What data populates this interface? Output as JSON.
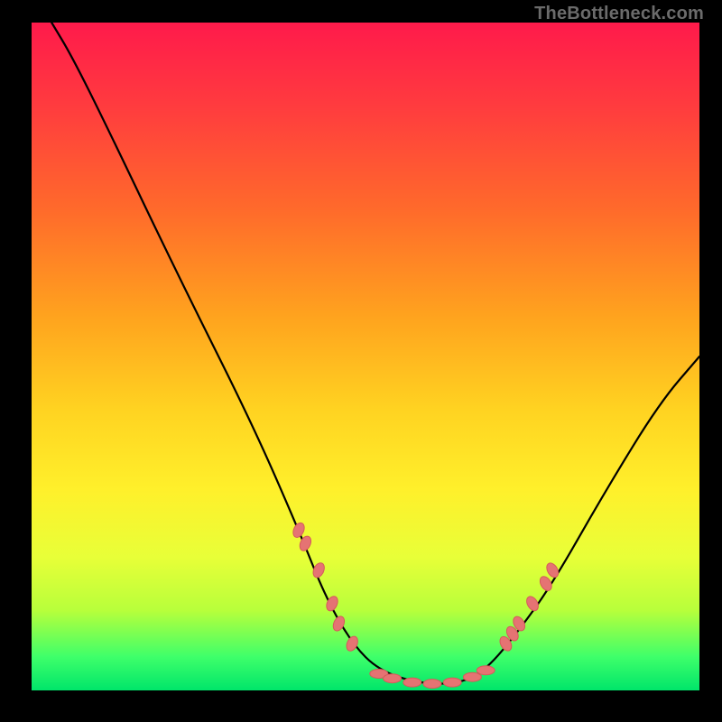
{
  "watermark": "TheBottleneck.com",
  "chart_data": {
    "type": "line",
    "title": "",
    "xlabel": "",
    "ylabel": "",
    "xlim": [
      0,
      100
    ],
    "ylim": [
      0,
      100
    ],
    "grid": false,
    "legend": false,
    "gradient_background": {
      "orientation": "vertical",
      "stops": [
        {
          "pos": 0,
          "color": "#ff1a4b"
        },
        {
          "pos": 12,
          "color": "#ff3a3f"
        },
        {
          "pos": 28,
          "color": "#ff6a2b"
        },
        {
          "pos": 44,
          "color": "#ffa31e"
        },
        {
          "pos": 58,
          "color": "#ffd321"
        },
        {
          "pos": 70,
          "color": "#fff02b"
        },
        {
          "pos": 80,
          "color": "#e8ff38"
        },
        {
          "pos": 88,
          "color": "#b8ff3b"
        },
        {
          "pos": 95,
          "color": "#3eff6a"
        },
        {
          "pos": 100,
          "color": "#00e56a"
        }
      ]
    },
    "series": [
      {
        "name": "bottleneck-curve",
        "color": "#000000",
        "points": [
          {
            "x": 3,
            "y": 100
          },
          {
            "x": 6,
            "y": 95
          },
          {
            "x": 11,
            "y": 85
          },
          {
            "x": 22,
            "y": 62
          },
          {
            "x": 33,
            "y": 40
          },
          {
            "x": 40,
            "y": 24
          },
          {
            "x": 44,
            "y": 14
          },
          {
            "x": 48,
            "y": 7
          },
          {
            "x": 52,
            "y": 3
          },
          {
            "x": 58,
            "y": 1
          },
          {
            "x": 64,
            "y": 1
          },
          {
            "x": 68,
            "y": 3
          },
          {
            "x": 73,
            "y": 9
          },
          {
            "x": 78,
            "y": 16
          },
          {
            "x": 86,
            "y": 30
          },
          {
            "x": 94,
            "y": 43
          },
          {
            "x": 100,
            "y": 50
          }
        ]
      }
    ],
    "markers": {
      "color": "#e57373",
      "left_arm": [
        {
          "x": 40,
          "y": 24
        },
        {
          "x": 41,
          "y": 22
        },
        {
          "x": 43,
          "y": 18
        },
        {
          "x": 45,
          "y": 13
        },
        {
          "x": 46,
          "y": 10
        },
        {
          "x": 48,
          "y": 7
        }
      ],
      "valley": [
        {
          "x": 52,
          "y": 2.5
        },
        {
          "x": 54,
          "y": 1.8
        },
        {
          "x": 57,
          "y": 1.2
        },
        {
          "x": 60,
          "y": 1.0
        },
        {
          "x": 63,
          "y": 1.2
        },
        {
          "x": 66,
          "y": 2.0
        },
        {
          "x": 68,
          "y": 3.0
        }
      ],
      "right_arm": [
        {
          "x": 71,
          "y": 7
        },
        {
          "x": 72,
          "y": 8.5
        },
        {
          "x": 73,
          "y": 10
        },
        {
          "x": 75,
          "y": 13
        },
        {
          "x": 77,
          "y": 16
        },
        {
          "x": 78,
          "y": 18
        }
      ]
    }
  }
}
